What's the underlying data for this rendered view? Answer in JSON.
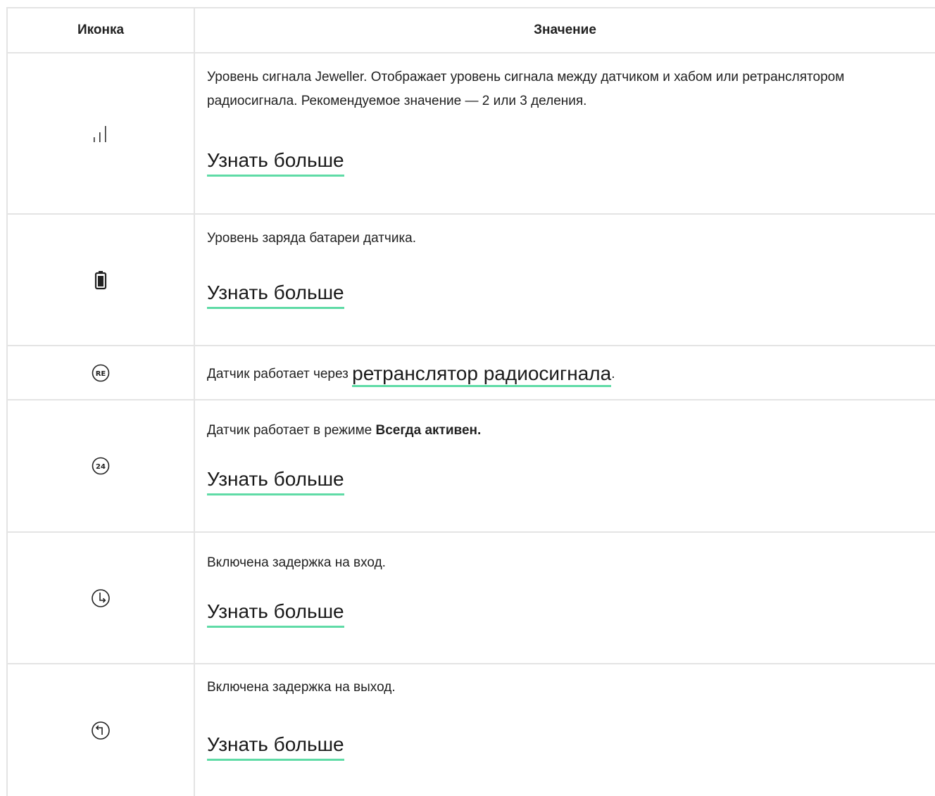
{
  "table": {
    "headers": {
      "icon": "Иконка",
      "meaning": "Значение"
    },
    "rows": [
      {
        "icon": "signal-strength-icon",
        "text": "Уровень сигнала Jeweller. Отображает уровень сигнала между датчиком и хабом или ретранслятором радиосигнала. Рекомендуемое значение — 2 или 3 деления.",
        "link": "Узнать больше"
      },
      {
        "icon": "battery-icon",
        "text": "Уровень заряда батареи датчика.",
        "link": "Узнать больше"
      },
      {
        "icon": "repeater-re-icon",
        "text_before": "Датчик работает через ",
        "inline_link": "ретранслятор радиосигнала",
        "text_after": "."
      },
      {
        "icon": "always-active-24-icon",
        "text_before": "Датчик работает в режиме ",
        "bold": "Всегда активен.",
        "link": "Узнать больше"
      },
      {
        "icon": "entry-delay-clock-icon",
        "text": "Включена задержка на вход.",
        "link": "Узнать больше"
      },
      {
        "icon": "exit-delay-clock-icon",
        "text": "Включена задержка на выход.",
        "link": "Узнать больше"
      }
    ]
  },
  "colors": {
    "link_underline": "#5fdba6",
    "grid": "#e4e4e4",
    "text": "#222222"
  }
}
